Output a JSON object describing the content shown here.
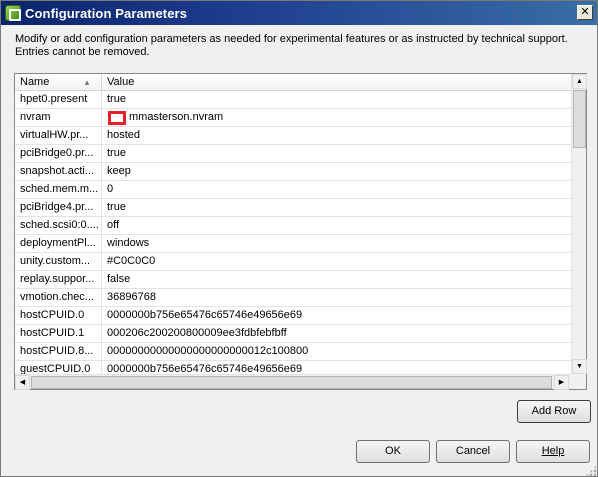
{
  "window": {
    "title": "Configuration Parameters",
    "close_glyph": "✕"
  },
  "intro": {
    "text": "Modify or add configuration parameters as needed for experimental features or as instructed by technical support. Entries cannot be removed."
  },
  "table": {
    "columns": [
      "Name",
      "Value"
    ],
    "sort_indicator": "▲",
    "rows": [
      {
        "name": "hpet0.present",
        "value": "true"
      },
      {
        "name": "nvram",
        "value": "mmasterson.nvram"
      },
      {
        "name": "virtualHW.pr...",
        "value": "hosted"
      },
      {
        "name": "pciBridge0.pr...",
        "value": "true"
      },
      {
        "name": "snapshot.acti...",
        "value": "keep"
      },
      {
        "name": "sched.mem.m...",
        "value": "0"
      },
      {
        "name": "pciBridge4.pr...",
        "value": "true"
      },
      {
        "name": "sched.scsi0:0....",
        "value": "off"
      },
      {
        "name": "deploymentPl...",
        "value": "windows"
      },
      {
        "name": "unity.custom...",
        "value": "#C0C0C0"
      },
      {
        "name": "replay.suppor...",
        "value": "false"
      },
      {
        "name": "vmotion.chec...",
        "value": "36896768"
      },
      {
        "name": "hostCPUID.0",
        "value": "0000000b756e65476c65746e49656e69"
      },
      {
        "name": "hostCPUID.1",
        "value": "000206c200200800009ee3fdbfebfbff"
      },
      {
        "name": "hostCPUID.8...",
        "value": "00000000000000000000000012c100800"
      },
      {
        "name": "guestCPUID.0",
        "value": "0000000b756e65476c65746e49656e69"
      }
    ]
  },
  "scrollbar": {
    "up": "▲",
    "down": "▼",
    "left": "◀",
    "right": "▶"
  },
  "buttons": {
    "add_row": "Add Row",
    "ok": "OK",
    "cancel": "Cancel",
    "help": "Help"
  },
  "colors": {
    "title_bar": "#0a246a",
    "highlight": "#e5202a"
  }
}
